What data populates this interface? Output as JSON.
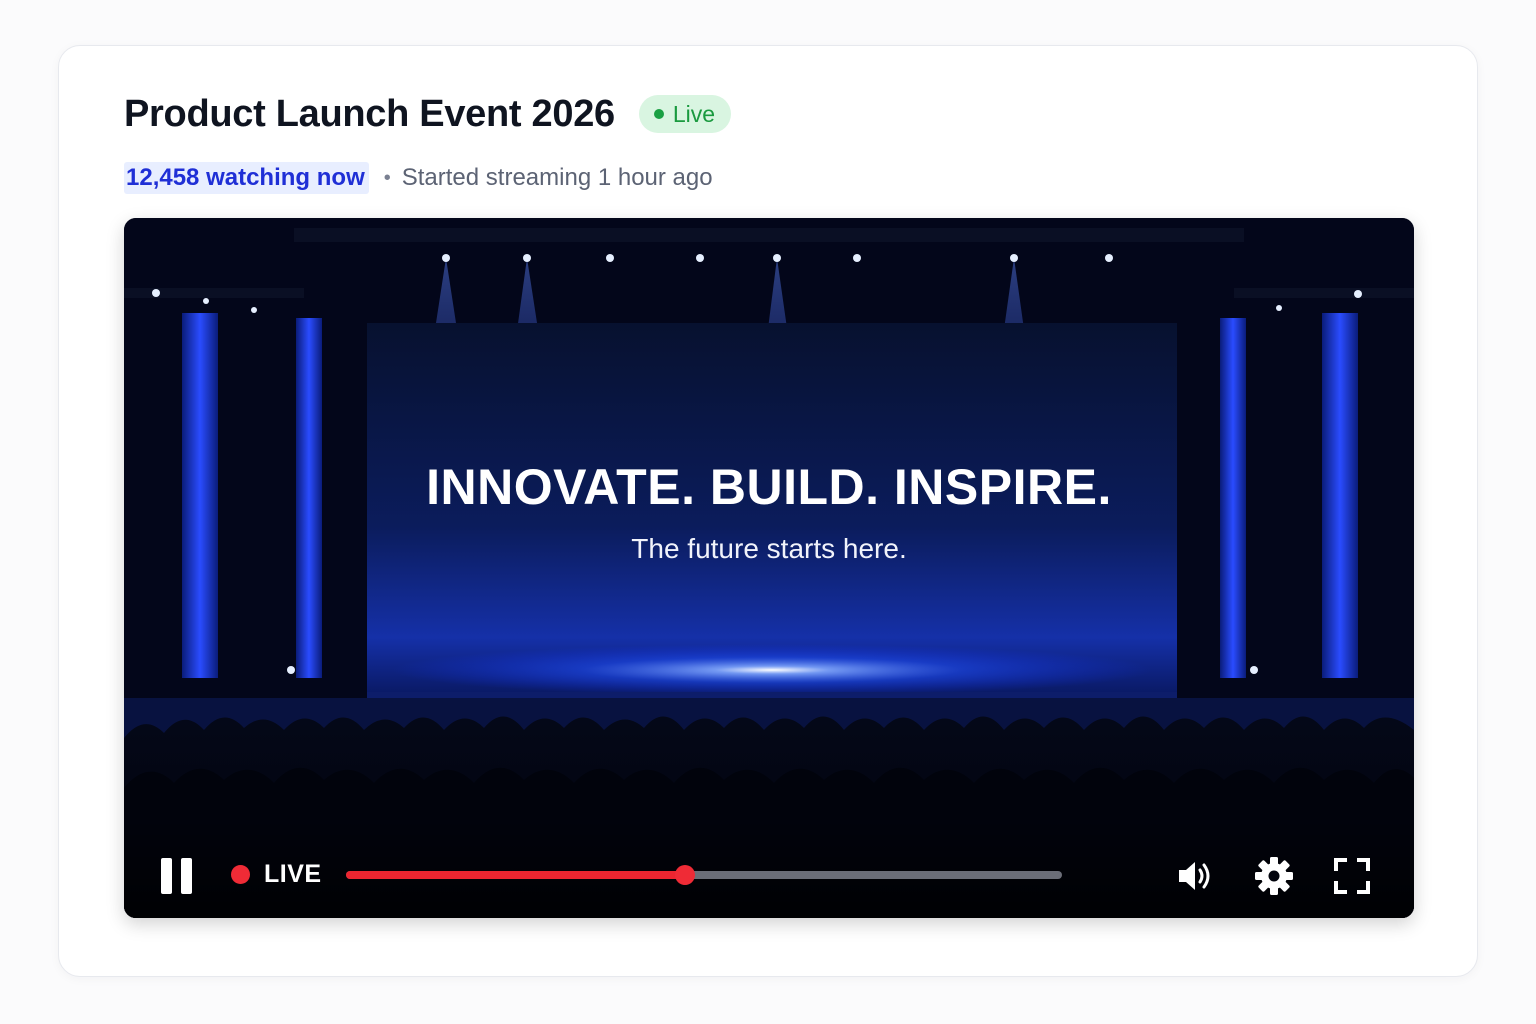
{
  "event": {
    "title": "Product Launch Event 2026",
    "status_badge": "Live",
    "viewers": "12,458 watching now",
    "separator": "•",
    "started": "Started streaming 1 hour ago"
  },
  "video": {
    "headline": "INNOVATE. BUILD. INSPIRE.",
    "tagline": "The future starts here."
  },
  "controls": {
    "live_label": "LIVE",
    "progress_fraction": 0.473,
    "icons": [
      "pause-icon",
      "volume-icon",
      "settings-gear-icon",
      "fullscreen-icon"
    ]
  },
  "colors": {
    "accent_red": "#ef2b36",
    "live_green": "#1a9a3f",
    "live_pill_bg": "#d9f5e1",
    "viewer_blue": "#1f2fd6",
    "stage_blue": "#1a3cff"
  }
}
